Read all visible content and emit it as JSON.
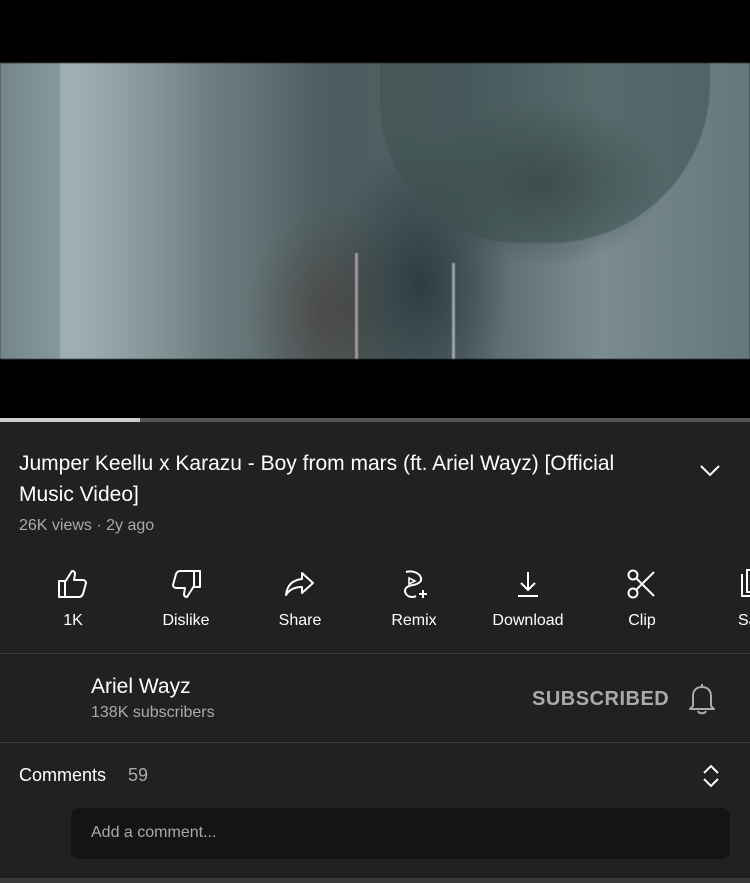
{
  "video": {
    "title": "Jumper Keellu x Karazu - Boy from mars (ft. Ariel Wayz) [Official Music Video]",
    "progress_fraction": 0.187,
    "views": "26K views",
    "separator": "·",
    "age": "2y ago"
  },
  "actions": [
    {
      "icon": "thumbs-up-icon",
      "label": "1K"
    },
    {
      "icon": "thumbs-down-icon",
      "label": "Dislike"
    },
    {
      "icon": "share-icon",
      "label": "Share"
    },
    {
      "icon": "remix-icon",
      "label": "Remix"
    },
    {
      "icon": "download-icon",
      "label": "Download"
    },
    {
      "icon": "clip-icon",
      "label": "Clip"
    },
    {
      "icon": "save-icon",
      "label": "Sa"
    }
  ],
  "channel": {
    "name": "Ariel Wayz",
    "subscribers": "138K subscribers",
    "subscribe_state": "SUBSCRIBED"
  },
  "comments": {
    "label": "Comments",
    "count": "59",
    "placeholder": "Add a comment..."
  },
  "colors": {
    "background": "#212121",
    "secondary_text": "#aaaaaa",
    "input_background": "#141414"
  }
}
